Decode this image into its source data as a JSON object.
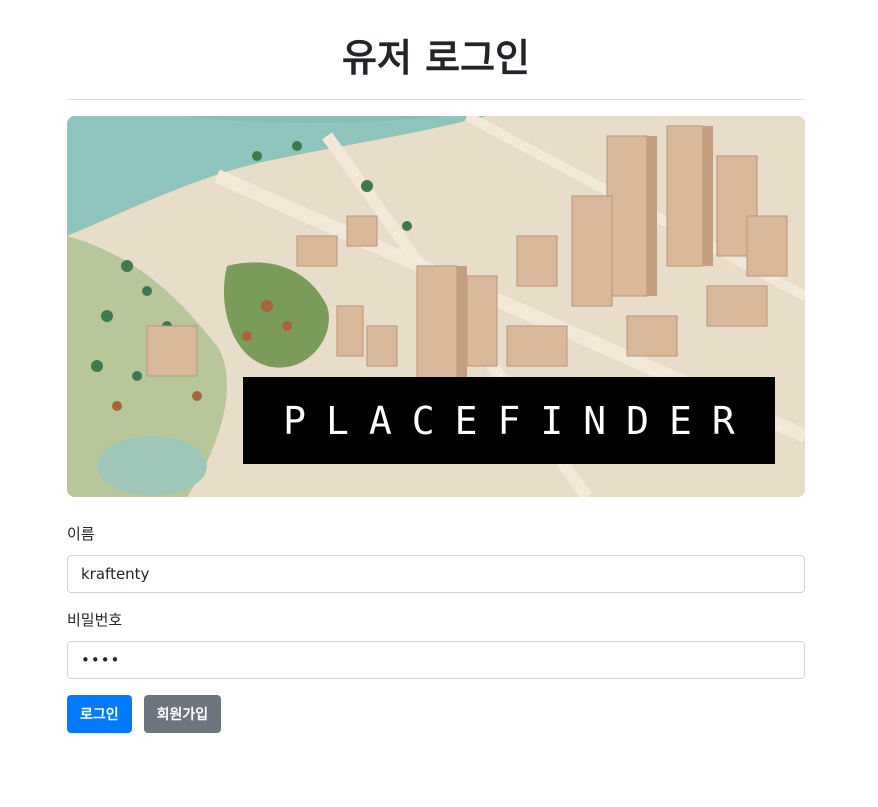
{
  "page": {
    "title": "유저 로그인"
  },
  "banner": {
    "brand_text": "PLACEFINDER"
  },
  "form": {
    "username": {
      "label": "이름",
      "value": "kraftenty"
    },
    "password": {
      "label": "비밀번호",
      "value": "••••"
    }
  },
  "buttons": {
    "login_label": "로그인",
    "signup_label": "회원가입"
  },
  "colors": {
    "primary": "#007bff",
    "secondary": "#6c757d"
  }
}
